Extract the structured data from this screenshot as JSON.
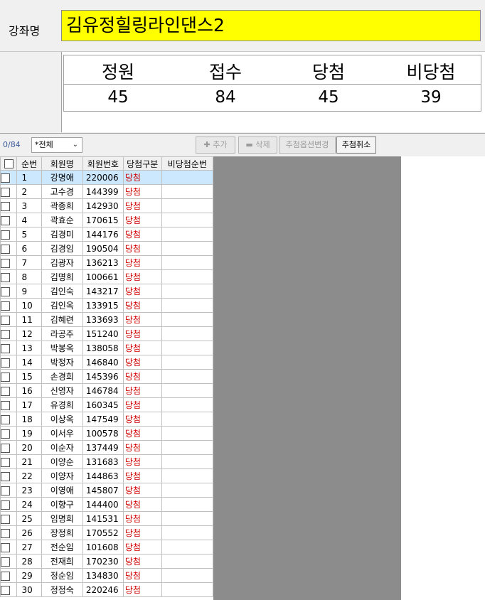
{
  "course": {
    "label": "강좌명",
    "name": "김유정힐링라인댄스2"
  },
  "stats": {
    "headers": [
      "정원",
      "접수",
      "당첨",
      "비당첨"
    ],
    "values": [
      "45",
      "84",
      "45",
      "39"
    ]
  },
  "toolbar": {
    "counter": "0/84",
    "filter_value": "*전체",
    "add_label": "추가",
    "delete_label": "삭제",
    "change_option_label": "추첨옵션변경",
    "cancel_draw_label": "추첨취소"
  },
  "grid": {
    "columns": [
      "순번",
      "회원명",
      "회원번호",
      "당첨구분",
      "비당첨순번"
    ],
    "rows": [
      [
        "1",
        "강명애",
        "220006",
        "당첨",
        ""
      ],
      [
        "2",
        "고수경",
        "144399",
        "당첨",
        ""
      ],
      [
        "3",
        "곽종희",
        "142930",
        "당첨",
        ""
      ],
      [
        "4",
        "곽효순",
        "170615",
        "당첨",
        ""
      ],
      [
        "5",
        "김경미",
        "144176",
        "당첨",
        ""
      ],
      [
        "6",
        "김경임",
        "190504",
        "당첨",
        ""
      ],
      [
        "7",
        "김광자",
        "136213",
        "당첨",
        ""
      ],
      [
        "8",
        "김명희",
        "100661",
        "당첨",
        ""
      ],
      [
        "9",
        "김인숙",
        "143217",
        "당첨",
        ""
      ],
      [
        "10",
        "김인옥",
        "133915",
        "당첨",
        ""
      ],
      [
        "11",
        "김혜련",
        "133693",
        "당첨",
        ""
      ],
      [
        "12",
        "라공주",
        "151240",
        "당첨",
        ""
      ],
      [
        "13",
        "박봉옥",
        "138058",
        "당첨",
        ""
      ],
      [
        "14",
        "박정자",
        "146840",
        "당첨",
        ""
      ],
      [
        "15",
        "손경희",
        "145396",
        "당첨",
        ""
      ],
      [
        "16",
        "신영자",
        "146784",
        "당첨",
        ""
      ],
      [
        "17",
        "유경희",
        "160345",
        "당첨",
        ""
      ],
      [
        "18",
        "이상옥",
        "147549",
        "당첨",
        ""
      ],
      [
        "19",
        "이서우",
        "100578",
        "당첨",
        ""
      ],
      [
        "20",
        "이순자",
        "137449",
        "당첨",
        ""
      ],
      [
        "21",
        "이양순",
        "131683",
        "당첨",
        ""
      ],
      [
        "22",
        "이양자",
        "144863",
        "당첨",
        ""
      ],
      [
        "23",
        "이영애",
        "145807",
        "당첨",
        ""
      ],
      [
        "24",
        "이향구",
        "144400",
        "당첨",
        ""
      ],
      [
        "25",
        "임명희",
        "141531",
        "당첨",
        ""
      ],
      [
        "26",
        "장정희",
        "170552",
        "당첨",
        ""
      ],
      [
        "27",
        "전순임",
        "101608",
        "당첨",
        ""
      ],
      [
        "28",
        "전재희",
        "170230",
        "당첨",
        ""
      ],
      [
        "29",
        "정순임",
        "134830",
        "당첨",
        ""
      ],
      [
        "30",
        "정정숙",
        "220246",
        "당첨",
        ""
      ]
    ]
  }
}
